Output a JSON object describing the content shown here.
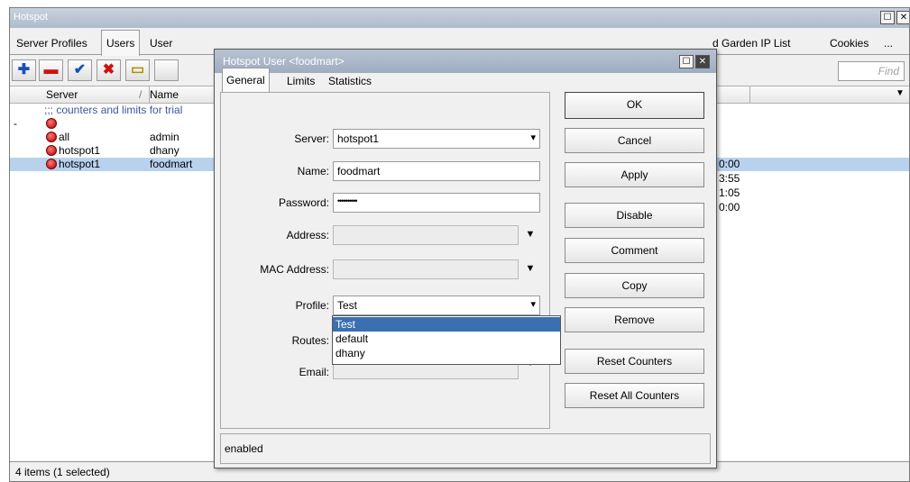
{
  "main": {
    "title": "Hotspot",
    "tabs": [
      "Server Profiles",
      "Users",
      "User",
      "d Garden IP List",
      "Cookies",
      "..."
    ],
    "find_placeholder": "Find",
    "columns": [
      "Server",
      "/",
      "Name"
    ],
    "comment_row": ";;; counters and limits for trial",
    "rows": [
      {
        "server": "",
        "name": ""
      },
      {
        "server": "all",
        "name": "admin",
        "time": "0:00"
      },
      {
        "server": "hotspot1",
        "name": "dhany",
        "time": "3:55"
      },
      {
        "server": "hotspot1",
        "name": "foodmart",
        "time": "1:05"
      }
    ],
    "row_extra_time": "0:00",
    "status": "4 items (1 selected)"
  },
  "dialog": {
    "title": "Hotspot User <foodmart>",
    "tabs": [
      "General",
      "Limits",
      "Statistics"
    ],
    "fields": {
      "server_label": "Server:",
      "server_value": "hotspot1",
      "name_label": "Name:",
      "name_value": "foodmart",
      "password_label": "Password:",
      "password_value": "••••••••••",
      "address_label": "Address:",
      "address_value": "",
      "mac_label": "MAC Address:",
      "mac_value": "",
      "profile_label": "Profile:",
      "profile_value": "Test",
      "routes_label": "Routes:",
      "email_label": "Email:"
    },
    "profile_options": [
      "Test",
      "default",
      "dhany"
    ],
    "buttons": [
      "OK",
      "Cancel",
      "Apply",
      "Disable",
      "Comment",
      "Copy",
      "Remove",
      "Reset Counters",
      "Reset All Counters"
    ],
    "status": "enabled"
  },
  "colors": {
    "selection": "#b8d2ee",
    "title_bar": "#aebccb",
    "dropdown_selected": "#3a6fb0"
  }
}
